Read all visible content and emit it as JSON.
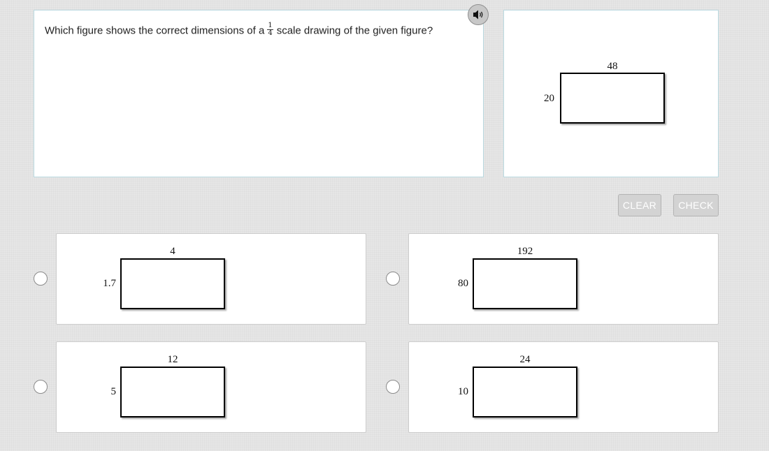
{
  "question": {
    "text_before": "Which figure shows the correct dimensions of a",
    "fraction_numerator": "1",
    "fraction_denominator": "4",
    "text_after": "scale drawing of the given figure?"
  },
  "audio_button": {
    "icon": "speaker-icon"
  },
  "given_figure": {
    "width": "48",
    "height": "20"
  },
  "buttons": {
    "clear": "CLEAR",
    "check": "CHECK"
  },
  "choices": [
    {
      "width": "4",
      "height": "1.7",
      "selected": false
    },
    {
      "width": "192",
      "height": "80",
      "selected": false
    },
    {
      "width": "12",
      "height": "5",
      "selected": false
    },
    {
      "width": "24",
      "height": "10",
      "selected": false
    }
  ],
  "colors": {
    "panel_border": "#b9d8df",
    "button_bg": "#d3d3d3",
    "button_text": "#ffffff"
  }
}
